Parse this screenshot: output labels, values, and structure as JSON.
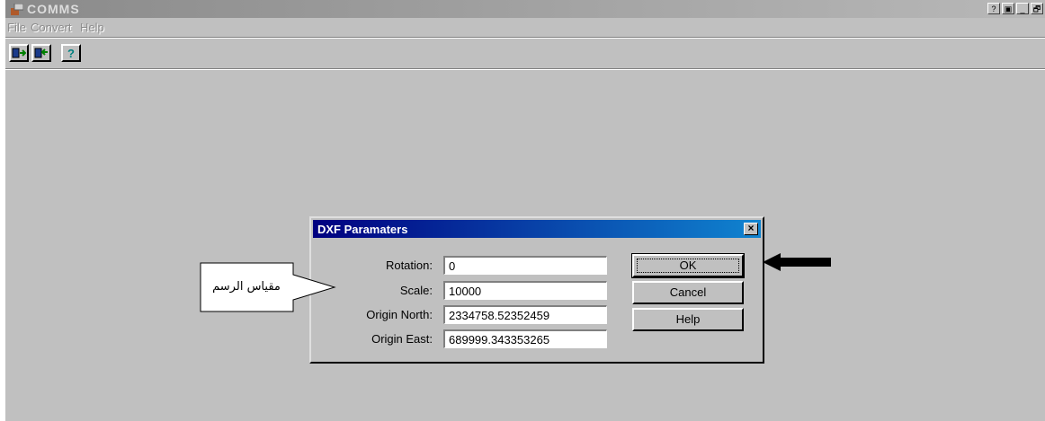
{
  "window": {
    "title": "COMMS",
    "controls": [
      "?",
      "▣",
      "_",
      "🗗"
    ]
  },
  "menu": {
    "items": [
      "File",
      "Convert",
      "Help"
    ]
  },
  "toolbar": {
    "buttons": [
      "import-icon",
      "export-icon",
      "help-icon"
    ]
  },
  "dialog": {
    "title": "DXF Paramaters",
    "close_label": "×",
    "fields": [
      {
        "label": "Rotation:",
        "value": "0"
      },
      {
        "label": "Scale:",
        "value": "10000"
      },
      {
        "label": "Origin North:",
        "value": "2334758.52352459"
      },
      {
        "label": "Origin East:",
        "value": "689999.343353265"
      }
    ],
    "buttons": {
      "ok": "OK",
      "cancel": "Cancel",
      "help": "Help"
    }
  },
  "annotation": {
    "callout_text": "مقياس الرسم"
  },
  "colors": {
    "dialog_title_start": "#000080",
    "dialog_title_end": "#1084d0",
    "face": "#c0c0c0"
  }
}
